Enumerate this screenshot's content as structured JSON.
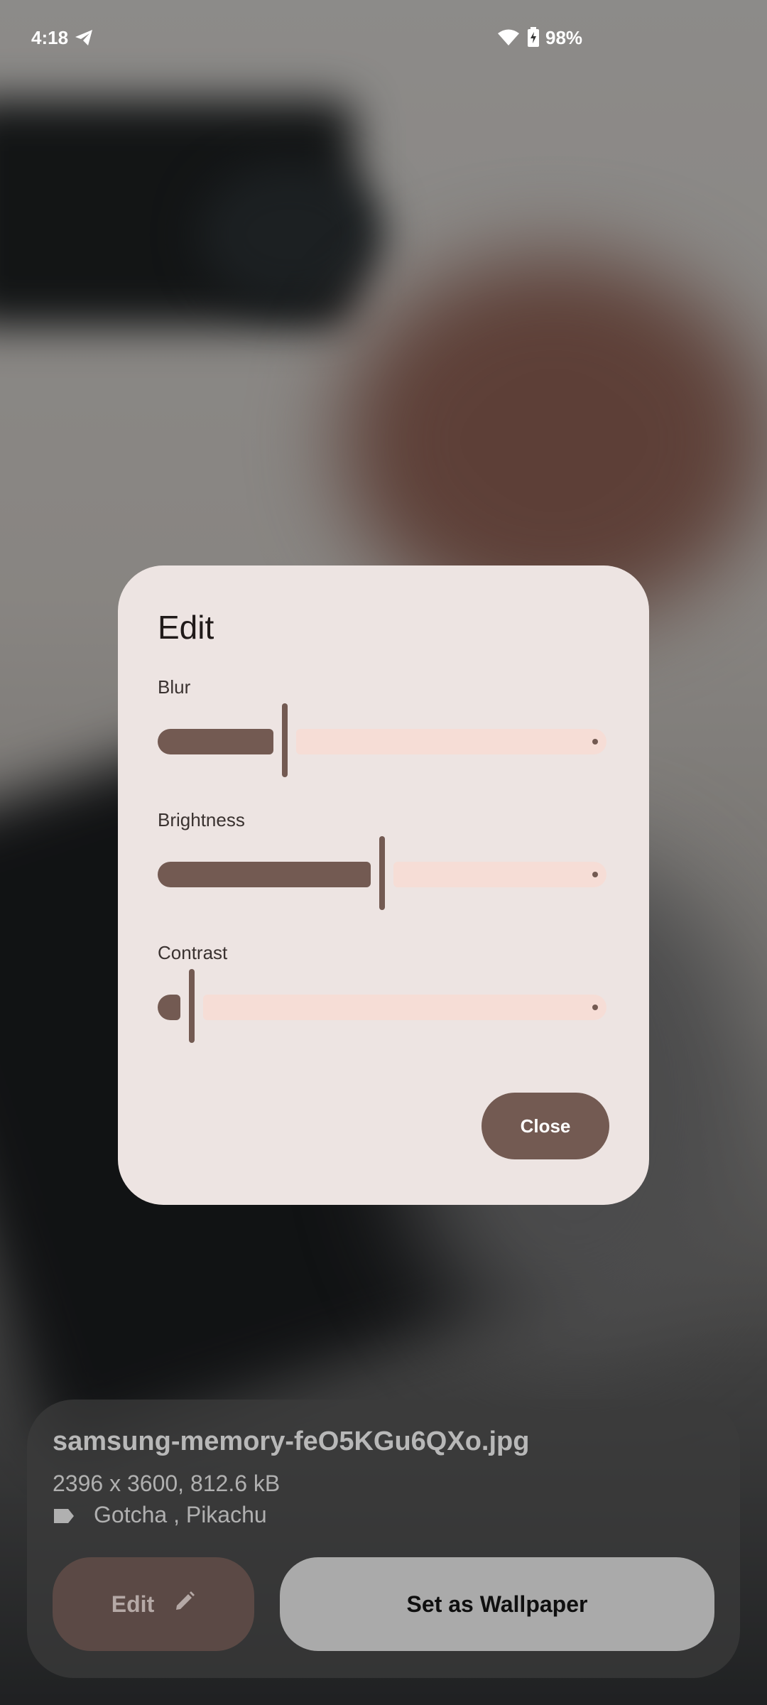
{
  "status_bar": {
    "time": "4:18",
    "battery_percent": "98%"
  },
  "icons": {
    "telegram": "telegram-icon",
    "wifi": "wifi-icon",
    "battery": "battery-charging-icon",
    "tag": "label-icon",
    "edit": "pencil-icon"
  },
  "dialog": {
    "title": "Edit",
    "sliders": [
      {
        "label": "Blur",
        "value": 0.28
      },
      {
        "label": "Brightness",
        "value": 0.5
      },
      {
        "label": "Contrast",
        "value": 0.07
      }
    ],
    "close_label": "Close"
  },
  "info": {
    "filename": "samsung-memory-feO5KGu6QXo.jpg",
    "meta": "2396 x 3600, 812.6 kB",
    "tags": "Gotcha , Pikachu",
    "edit_label": "Edit",
    "wallpaper_label": "Set as Wallpaper"
  },
  "colors": {
    "accent": "#735a52",
    "dialog_bg": "#ede4e2",
    "track_inactive": "#f6ddd6"
  }
}
